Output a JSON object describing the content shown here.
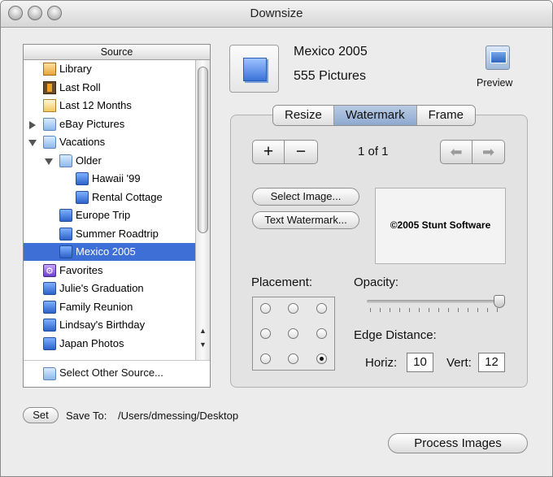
{
  "window": {
    "title": "Downsize"
  },
  "source": {
    "header": "Source",
    "items": [
      {
        "label": "Library",
        "icon": "library-icon"
      },
      {
        "label": "Last Roll",
        "icon": "film-roll-icon"
      },
      {
        "label": "Last 12 Months",
        "icon": "calendar-icon"
      },
      {
        "label": "eBay Pictures",
        "icon": "folder-icon"
      },
      {
        "label": "Vacations",
        "icon": "folder-icon"
      },
      {
        "label": "Older",
        "icon": "folder-icon"
      },
      {
        "label": "Hawaii '99",
        "icon": "album-icon"
      },
      {
        "label": "Rental Cottage",
        "icon": "album-icon"
      },
      {
        "label": "Europe Trip",
        "icon": "album-icon"
      },
      {
        "label": "Summer Roadtrip",
        "icon": "album-icon"
      },
      {
        "label": "Mexico 2005",
        "icon": "album-icon"
      },
      {
        "label": "Favorites",
        "icon": "smart-album-icon"
      },
      {
        "label": "Julie's Graduation",
        "icon": "album-icon"
      },
      {
        "label": "Family Reunion",
        "icon": "album-icon"
      },
      {
        "label": "Lindsay's Birthday",
        "icon": "album-icon"
      },
      {
        "label": "Japan Photos",
        "icon": "album-icon"
      }
    ],
    "selected": "Mexico 2005",
    "footer_label": "Select Other Source..."
  },
  "album": {
    "name": "Mexico 2005",
    "count": "555 Pictures"
  },
  "preview_label": "Preview",
  "tabs": [
    "Resize",
    "Watermark",
    "Frame"
  ],
  "active_tab": "Watermark",
  "watermark": {
    "add_label": "+",
    "remove_label": "−",
    "page_indicator": "1 of 1",
    "select_image_label": "Select Image...",
    "text_watermark_label": "Text Watermark...",
    "preview_text": "©2005 Stunt Software",
    "placement_label": "Placement:",
    "placement_selected": "bottom-right",
    "opacity_label": "Opacity:",
    "opacity_value": 1.0,
    "edge_distance_label": "Edge Distance:",
    "horiz_label": "Horiz:",
    "horiz_value": "10",
    "vert_label": "Vert:",
    "vert_value": "12"
  },
  "bottom": {
    "set_label": "Set",
    "save_to_label": "Save To:",
    "save_path": "/Users/dmessing/Desktop",
    "process_label": "Process Images"
  }
}
